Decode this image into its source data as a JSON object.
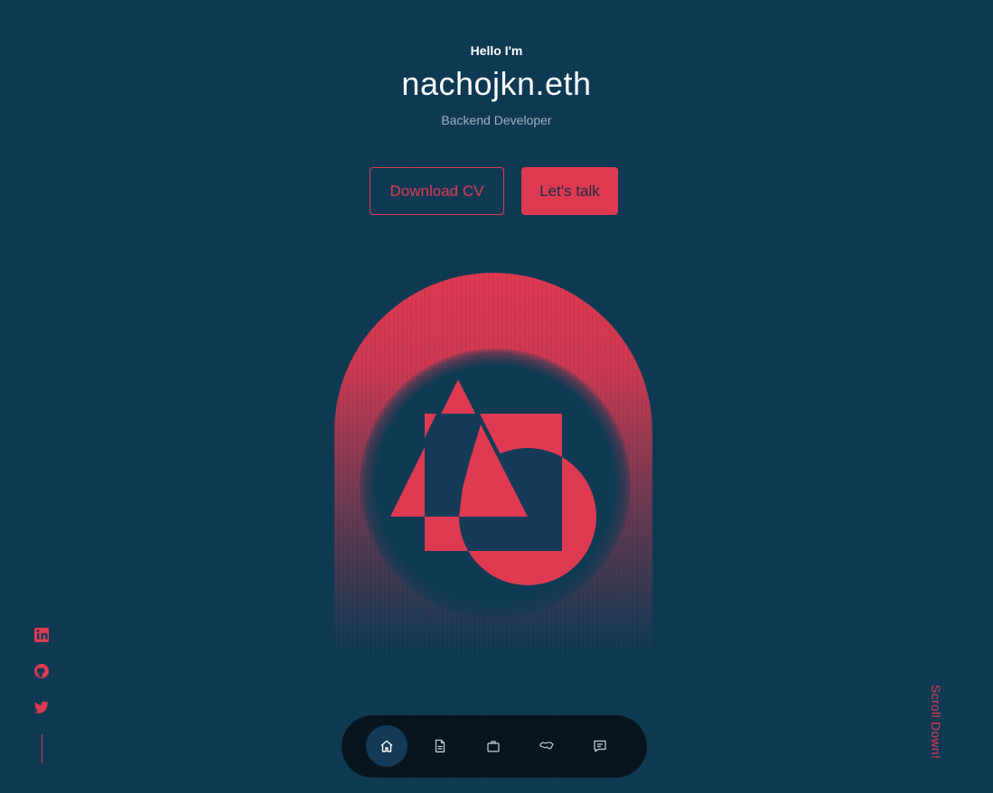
{
  "hero": {
    "greeting": "Hello I'm",
    "name": "nachojkn.eth",
    "role": "Backend Developer"
  },
  "buttons": {
    "download_cv": "Download CV",
    "lets_talk": "Let's talk"
  },
  "socials": [
    {
      "icon": "linkedin-icon"
    },
    {
      "icon": "github-icon"
    },
    {
      "icon": "twitter-icon"
    }
  ],
  "scroll_hint": "Scroll Down!",
  "nav": {
    "items": [
      {
        "icon": "home-icon",
        "active": true
      },
      {
        "icon": "document-icon",
        "active": false
      },
      {
        "icon": "briefcase-icon",
        "active": false
      },
      {
        "icon": "handshake-icon",
        "active": false
      },
      {
        "icon": "message-icon",
        "active": false
      }
    ]
  },
  "colors": {
    "background": "#0f3a54",
    "accent": "#de3a52",
    "nav_bg": "#08151f",
    "nav_active": "#133a56",
    "muted_text": "#9bb0c0"
  }
}
